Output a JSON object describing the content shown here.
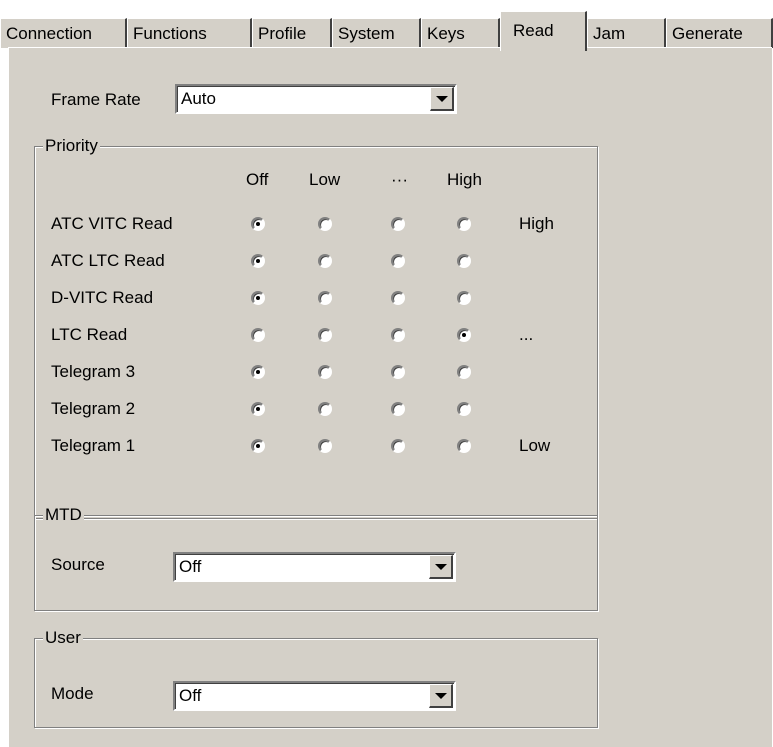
{
  "tabs": [
    {
      "label": "Connection",
      "active": false
    },
    {
      "label": "Functions",
      "active": false
    },
    {
      "label": "Profile",
      "active": false
    },
    {
      "label": "System",
      "active": false
    },
    {
      "label": "Keys",
      "active": false
    },
    {
      "label": "Read",
      "active": true
    },
    {
      "label": "Jam",
      "active": false
    },
    {
      "label": "Generate",
      "active": false
    }
  ],
  "frame_rate": {
    "label": "Frame Rate",
    "value": "Auto"
  },
  "priority": {
    "title": "Priority",
    "columns": [
      "Off",
      "Low",
      "···",
      "High"
    ],
    "rows": [
      {
        "label": "ATC VITC Read",
        "selected": 0,
        "rank": "High"
      },
      {
        "label": "ATC LTC Read",
        "selected": 0,
        "rank": ""
      },
      {
        "label": "D-VITC Read",
        "selected": 0,
        "rank": ""
      },
      {
        "label": "LTC Read",
        "selected": 3,
        "rank": "..."
      },
      {
        "label": "Telegram 3",
        "selected": 0,
        "rank": ""
      },
      {
        "label": "Telegram 2",
        "selected": 0,
        "rank": ""
      },
      {
        "label": "Telegram 1",
        "selected": 0,
        "rank": "Low"
      }
    ]
  },
  "mtd": {
    "title": "MTD",
    "source_label": "Source",
    "source_value": "Off"
  },
  "user": {
    "title": "User",
    "mode_label": "Mode",
    "mode_value": "Off"
  },
  "colors": {
    "face": "#d4d0c8",
    "shadow": "#808080",
    "dark_shadow": "#404040",
    "highlight": "#ffffff"
  }
}
